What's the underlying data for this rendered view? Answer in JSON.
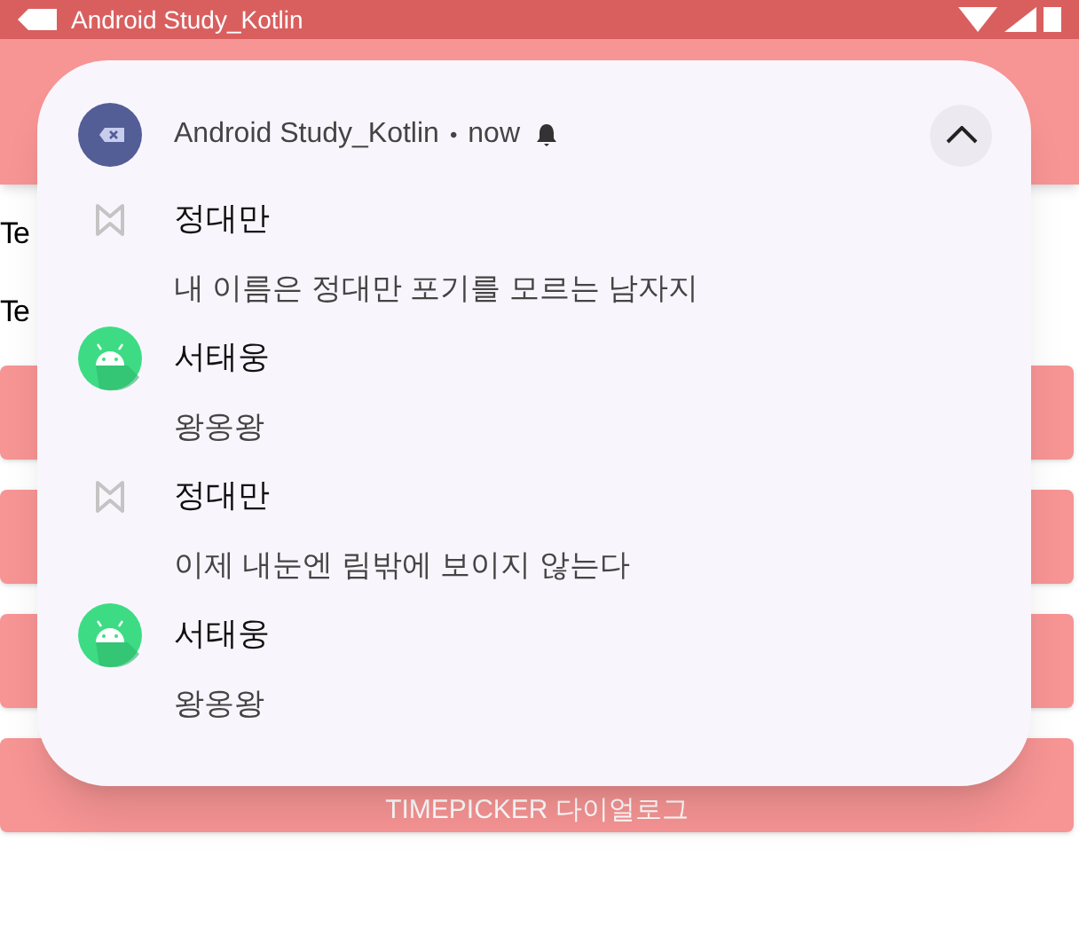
{
  "status_bar": {
    "title": "Android Study_Kotlin"
  },
  "screen": {
    "texts": [
      "Te",
      "Te"
    ],
    "buttons": [
      {
        "kind": "covered"
      },
      {
        "kind": "covered"
      },
      {
        "kind": "covered"
      },
      {
        "kind": "labeled",
        "label": "TIMEPICKER 다이얼로그"
      }
    ]
  },
  "notification": {
    "app": "Android Study_Kotlin",
    "separator": "•",
    "time": "now",
    "alerting": true,
    "expanded": true,
    "messages": [
      {
        "kind": "placeholder",
        "sender": "정대만",
        "text": "내 이름은 정대만 포기를 모르는 남자지"
      },
      {
        "kind": "robot",
        "sender": "서태웅",
        "text": "왕옹왕"
      },
      {
        "kind": "placeholder",
        "sender": "정대만",
        "text": "이제 내눈엔 림밖에 보이지 않는다"
      },
      {
        "kind": "robot",
        "sender": "서태웅",
        "text": "왕옹왕"
      }
    ]
  }
}
